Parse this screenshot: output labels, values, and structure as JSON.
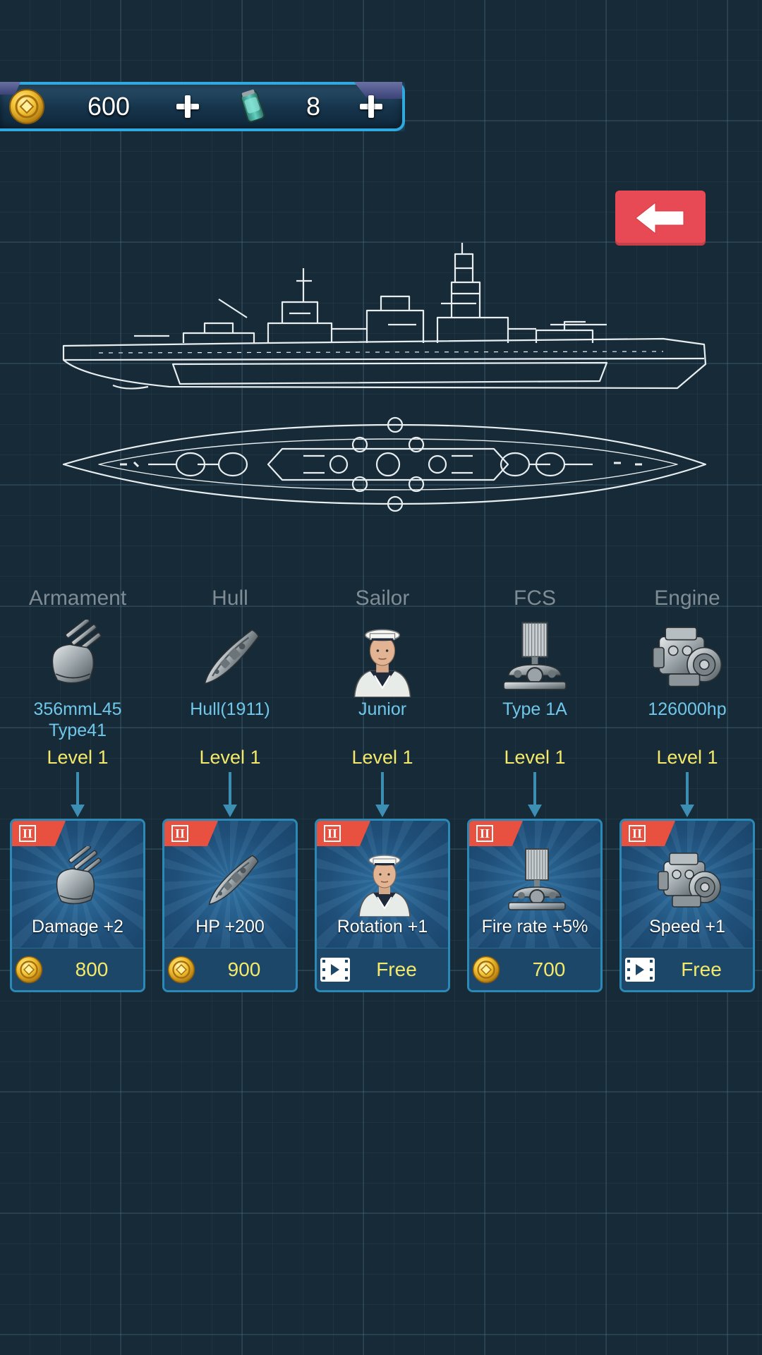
{
  "currency": {
    "coins": "600",
    "fuel": "8",
    "coin_icon": "gold-coin-icon",
    "fuel_icon": "fuel-canister-icon"
  },
  "back_icon": "arrow-left-icon",
  "colors": {
    "accent": "#2fa9e0",
    "back_button": "#e84a55",
    "level_text": "#f5e96a",
    "item_text": "#6fc7ea",
    "tier_badge": "#e8513f"
  },
  "categories": [
    {
      "title": "Armament",
      "icon": "cannon-turret-icon",
      "item_name": "356mmL45\nType41",
      "level": "Level 1",
      "tier": "II",
      "effect": "Damage +2",
      "cost_type": "coin",
      "cost": "800"
    },
    {
      "title": "Hull",
      "icon": "ship-hull-icon",
      "item_name": "Hull(1911)",
      "level": "Level 1",
      "tier": "II",
      "effect": "HP +200",
      "cost_type": "coin",
      "cost": "900"
    },
    {
      "title": "Sailor",
      "icon": "sailor-icon",
      "item_name": "Junior",
      "level": "Level 1",
      "tier": "II",
      "effect": "Rotation +1",
      "cost_type": "video",
      "cost": "Free"
    },
    {
      "title": "FCS",
      "icon": "radar-fcs-icon",
      "item_name": "Type 1A",
      "level": "Level 1",
      "tier": "II",
      "effect": "Fire rate +5%",
      "cost_type": "coin",
      "cost": "700"
    },
    {
      "title": "Engine",
      "icon": "engine-icon",
      "item_name": "126000hp",
      "level": "Level 1",
      "tier": "II",
      "effect": "Speed +1",
      "cost_type": "video",
      "cost": "Free"
    }
  ]
}
